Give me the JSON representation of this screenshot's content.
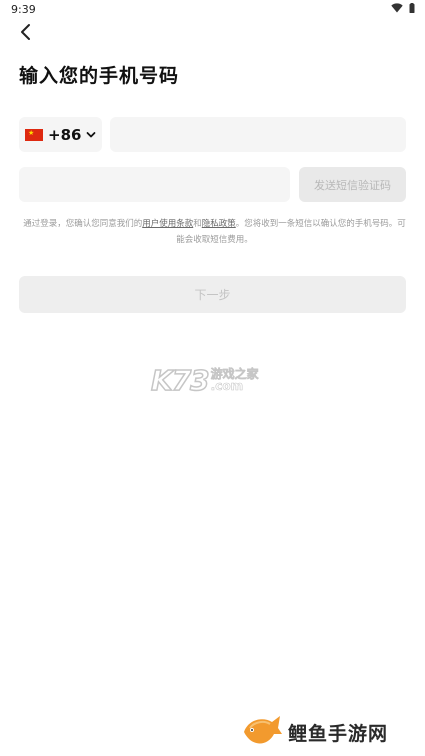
{
  "status_bar": {
    "time": "9:39",
    "icons": [
      "wifi-icon",
      "battery-icon"
    ]
  },
  "header": {
    "back_icon": "chevron-left-icon",
    "title": "输入您的手机号码"
  },
  "form": {
    "country": {
      "flag": "china-flag-icon",
      "code": "+86",
      "chevron": "chevron-down-icon"
    },
    "phone": {
      "value": "",
      "placeholder": ""
    },
    "verify_code": {
      "value": "",
      "placeholder": ""
    },
    "send_code_label": "发送短信验证码"
  },
  "agreement": {
    "prefix": "通过登录，您确认您同意我们的",
    "terms_link": "用户使用条款",
    "and": "和",
    "privacy_link": "隐私政策",
    "suffix": "。您将收到一条短信以确认您的手机号码。可能会收取短信费用。"
  },
  "next_button_label": "下一步",
  "watermarks": {
    "k73_main": "K73",
    "k73_cn": "游戏之家",
    "k73_com": ".com",
    "bottom_text": "鲤鱼手游网"
  },
  "colors": {
    "field_bg": "#f5f5f5",
    "disabled_button_bg": "#eeeeee",
    "disabled_text": "#c4c4c4",
    "flag_red": "#de2910",
    "fish_orange": "#f29a2e"
  }
}
